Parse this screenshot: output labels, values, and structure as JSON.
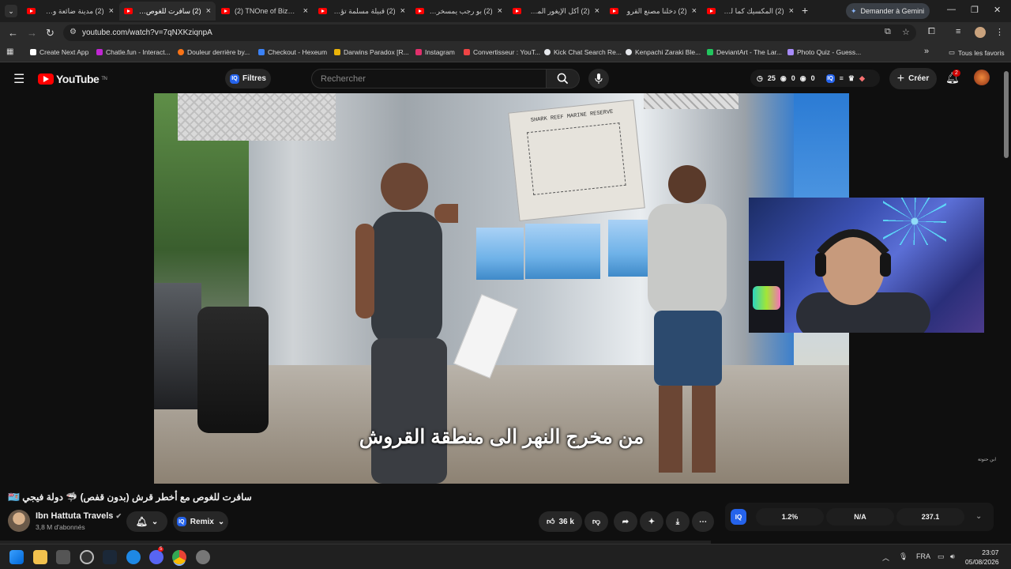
{
  "browser": {
    "tabs": [
      {
        "title": "(2) مدينة ضائعة وسط"
      },
      {
        "title": "(2) سافرت للغوص مع",
        "active": true
      },
      {
        "title": "(2) TNOne of Bizerte's"
      },
      {
        "title": "(2) قبيلة مسلمة تؤمن"
      },
      {
        "title": "(2) بو رجب يمسخر الم"
      },
      {
        "title": "(2) أكل الإيغور المسلم"
      },
      {
        "title": "(2) دخلنا مصنع القرو"
      },
      {
        "title": "(2) المكسيك كما لم تر"
      }
    ],
    "gemini_button": "Demander à Gemini",
    "url": "youtube.com/watch?v=7qNXKziqnpA",
    "bookmarks": [
      {
        "label": "Create Next App",
        "color": "#ffffff"
      },
      {
        "label": "Chatle.fun - Interact...",
        "color": "#c026d3"
      },
      {
        "label": "Douleur derrière by...",
        "color": "#f97316"
      },
      {
        "label": "Checkout - Hexeum",
        "color": "#3b82f6"
      },
      {
        "label": "Darwins Paradox [R...",
        "color": "#eab308"
      },
      {
        "label": "Instagram",
        "color": "#e1306c"
      },
      {
        "label": "Convertisseur : YouT...",
        "color": "#ef4444"
      },
      {
        "label": "Kick Chat Search Re...",
        "color": "#e5e7eb"
      },
      {
        "label": "Kenpachi Zaraki Ble...",
        "color": "#e5e7eb"
      },
      {
        "label": "DeviantArt - The Lar...",
        "color": "#22c55e"
      },
      {
        "label": "Photo Quiz - Guess...",
        "color": "#a78bfa"
      }
    ],
    "all_favorites": "Tous les favoris"
  },
  "youtube": {
    "logo": "YouTube",
    "logo_sup": "TN",
    "filters": "Filtres",
    "search_placeholder": "Rechercher",
    "counters": [
      "25",
      "0",
      "0"
    ],
    "create": "Créer",
    "notif_count": "2"
  },
  "video": {
    "poster_text": "SHARK REEF MARINE RESERVE",
    "subtitle": "من مخرج النهر الى منطقة القروش",
    "watermark": "ابن حتوتة",
    "title": "سافرت للغوص مع أخطر قرش (بدون قفص) 🦈 دولة فيجي 🇫🇯",
    "channel": "Ibn Hattuta Travels",
    "subscribers": "3,8 M d'abonnés",
    "remix": "Remix",
    "likes": "36 k",
    "iq_stats": [
      "1.2%",
      "N/A",
      "237.1"
    ],
    "iq_label": "IQ"
  },
  "taskbar": {
    "lang": "FRA",
    "time": "23:07",
    "date": "05/08/2026",
    "badge": "5"
  }
}
